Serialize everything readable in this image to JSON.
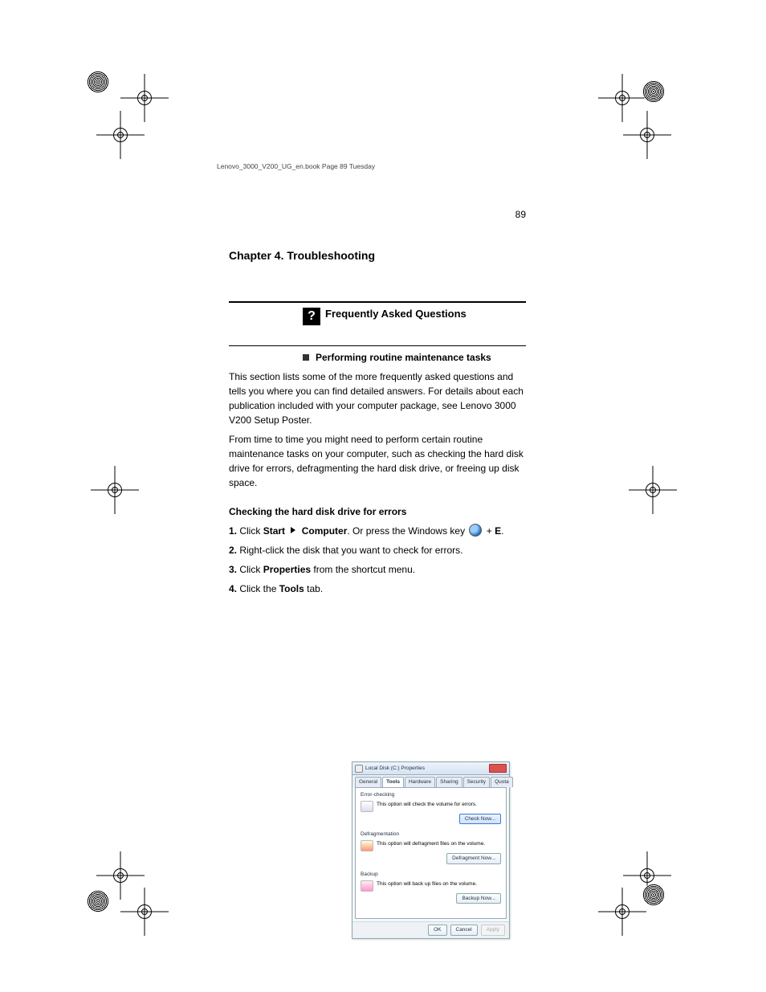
{
  "page_number": "89",
  "chapter_title": "Chapter 4. Troubleshooting",
  "faq": {
    "heading": "Frequently Asked Questions",
    "item_title": "Performing routine maintenance tasks",
    "paragraphs": [
      "This section lists some of the more frequently asked questions and tells you where you can find detailed answers. For details about each publication included with your computer package, see Lenovo 3000 V200 Setup Poster.",
      "From time to time you might need to perform certain routine maintenance tasks on your computer, such as checking the hard disk drive for errors, defragmenting the hard disk drive, or freeing up disk space."
    ],
    "lead_in": "Checking the hard disk drive for errors",
    "steps": [
      {
        "n": "1",
        "html": "Click <b>Start</b> <tri></tri> <b>Computer</b>. Or press the Windows key <orb></orb> + <b>E</b>."
      },
      {
        "n": "2",
        "html": "Right-click the disk that you want to check for errors."
      },
      {
        "n": "3",
        "html": "Click <b>Properties</b> from the shortcut menu."
      },
      {
        "n": "4",
        "html": "Click the <b>Tools</b> tab."
      }
    ]
  },
  "dialog": {
    "title": "Local Disk (C:) Properties",
    "tabs": [
      "General",
      "Tools",
      "Hardware",
      "Sharing",
      "Security",
      "Quota"
    ],
    "active_tab": 1,
    "groups": {
      "error": {
        "header": "Error-checking",
        "text": "This option will check the volume for errors.",
        "button": "Check Now..."
      },
      "defrag": {
        "header": "Defragmentation",
        "text": "This option will defragment files on the volume.",
        "button": "Defragment Now..."
      },
      "backup": {
        "header": "Backup",
        "text": "This option will back up files on the volume.",
        "button": "Backup Now..."
      }
    },
    "footer": {
      "ok": "OK",
      "cancel": "Cancel",
      "apply": "Apply"
    }
  },
  "spine_text": "Lenovo_3000_V200_UG_en.book  Page 89  Tuesday"
}
